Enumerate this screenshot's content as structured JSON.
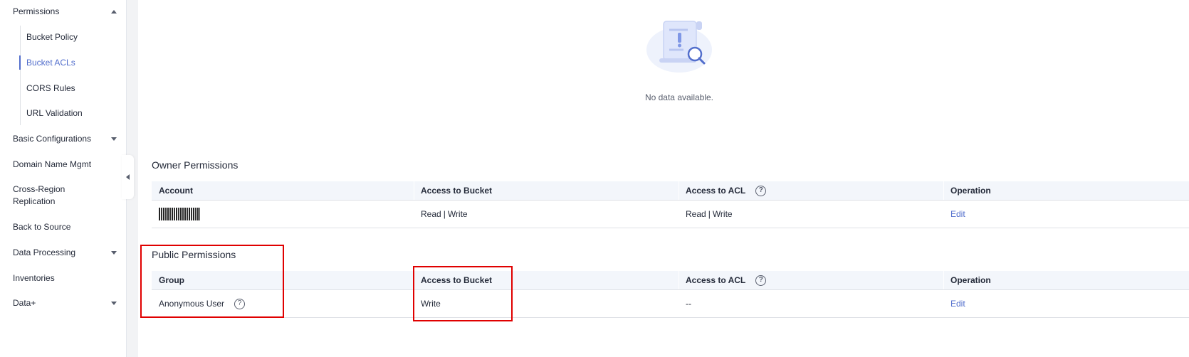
{
  "sidebar": {
    "permissions": "Permissions",
    "sub_items": [
      "Bucket Policy",
      "Bucket ACLs",
      "CORS Rules",
      "URL Validation"
    ],
    "basic_configurations": "Basic Configurations",
    "domain_name_mgmt": "Domain Name Mgmt",
    "cross_region_1": "Cross-Region",
    "cross_region_2": "Replication",
    "back_to_source": "Back to Source",
    "data_processing": "Data Processing",
    "inventories": "Inventories",
    "data_plus": "Data+"
  },
  "empty": {
    "text": "No data available."
  },
  "owner": {
    "title": "Owner Permissions",
    "headers": [
      "Account",
      "Access to Bucket",
      "Access to ACL",
      "Operation"
    ],
    "row": {
      "read": "Read",
      "sep": "|",
      "write": "Write",
      "acl_read": "Read",
      "acl_write": "Write",
      "operation": "Edit"
    }
  },
  "public": {
    "title": "Public Permissions",
    "headers": [
      "Group",
      "Access to Bucket",
      "Access to ACL",
      "Operation"
    ],
    "row": {
      "group": "Anonymous User",
      "bucket": "Write",
      "acl": "--",
      "operation": "Edit"
    }
  },
  "help_glyph": "?",
  "colors": {
    "accent": "#526ecc",
    "highlight": "#e00000",
    "header_bg": "#f3f6fb"
  }
}
